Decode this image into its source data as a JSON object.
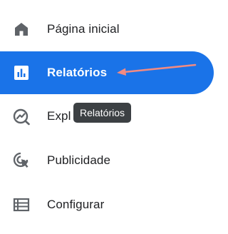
{
  "nav": {
    "items": [
      {
        "label": "Página inicial",
        "icon": "home-icon"
      },
      {
        "label": "Relatórios",
        "icon": "bar-chart-icon",
        "active": true
      },
      {
        "label": "Expl",
        "icon": "explore-icon"
      },
      {
        "label": "Publicidade",
        "icon": "advertising-icon"
      },
      {
        "label": "Configurar",
        "icon": "list-icon"
      }
    ]
  },
  "tooltip": {
    "text": "Relatórios"
  },
  "colors": {
    "accent": "#1a73e8",
    "icon": "#5f6368",
    "text": "#202124",
    "tooltip_bg": "#3c4043",
    "annotation": "#f28b82"
  }
}
